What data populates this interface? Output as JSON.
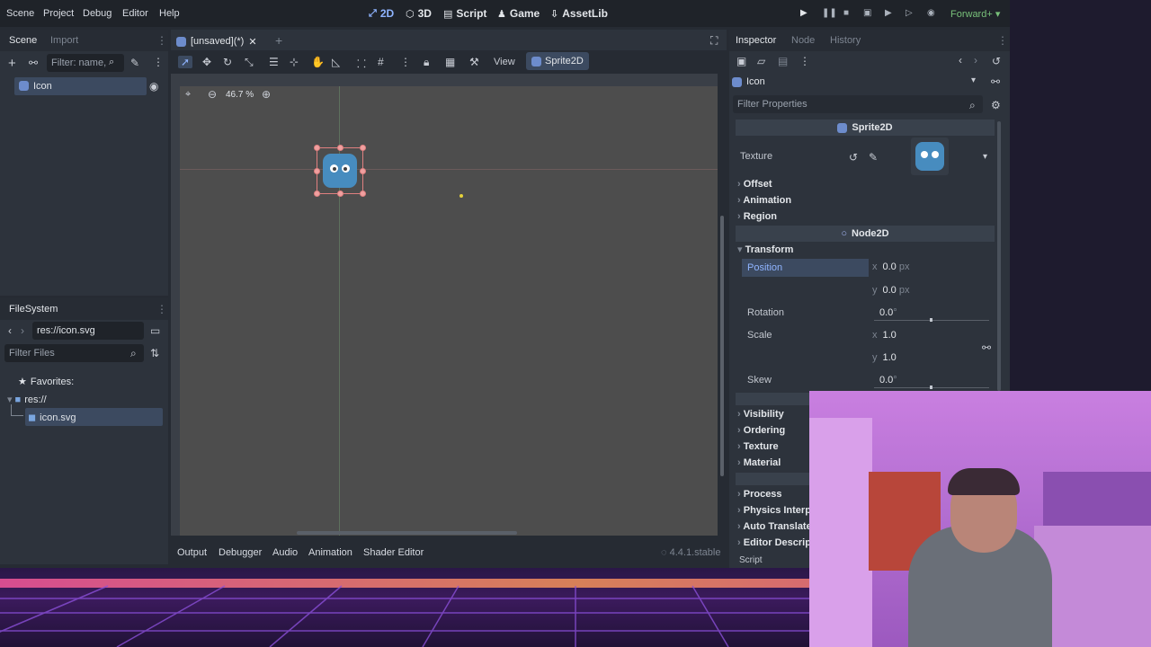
{
  "menu": [
    "Scene",
    "Project",
    "Debug",
    "Editor",
    "Help"
  ],
  "workspaces": [
    {
      "label": "2D",
      "icon": "2d-icon",
      "active": true
    },
    {
      "label": "3D",
      "icon": "3d-icon",
      "active": false
    },
    {
      "label": "Script",
      "icon": "script-icon",
      "active": false
    },
    {
      "label": "Game",
      "icon": "game-icon",
      "active": false
    },
    {
      "label": "AssetLib",
      "icon": "assetlib-icon",
      "active": false
    }
  ],
  "renderer": "Forward+",
  "scene_dock": {
    "tabs": [
      "Scene",
      "Import"
    ],
    "filter_placeholder": "Filter: name,",
    "tree": [
      {
        "label": "Icon",
        "selected": true
      }
    ]
  },
  "filesystem": {
    "title": "FileSystem",
    "path": "res://icon.svg",
    "filter_placeholder": "Filter Files",
    "items": [
      {
        "label": "Favorites:",
        "icon": "star-icon"
      },
      {
        "label": "res://",
        "icon": "folder-icon"
      },
      {
        "label": "icon.svg",
        "icon": "file-icon",
        "selected": true
      }
    ]
  },
  "editor": {
    "scene_tab": "[unsaved](*)",
    "view_label": "View",
    "node_label": "Sprite2D",
    "zoom": "46.7 %"
  },
  "bottom_tabs": [
    "Output",
    "Debugger",
    "Audio",
    "Animation",
    "Shader Editor"
  ],
  "version": "4.4.1.stable",
  "inspector": {
    "tabs": [
      "Inspector",
      "Node",
      "History"
    ],
    "object": "Icon",
    "filter_placeholder": "Filter Properties",
    "class_sprite": "Sprite2D",
    "texture_label": "Texture",
    "sprite_groups": [
      "Offset",
      "Animation",
      "Region"
    ],
    "class_node2d": "Node2D",
    "transform_label": "Transform",
    "position_label": "Position",
    "pos_x": "0.0",
    "pos_y": "0.0",
    "px": "px",
    "rotation_label": "Rotation",
    "rotation": "0.0",
    "deg": "°",
    "scale_label": "Scale",
    "scale_x": "1.0",
    "scale_y": "1.0",
    "skew_label": "Skew",
    "skew": "0.0",
    "canvas_groups": [
      "Visibility",
      "Ordering",
      "Texture",
      "Material"
    ],
    "node_groups": [
      "Process",
      "Physics Interp",
      "Auto Translate",
      "Editor Descrip"
    ],
    "script_label": "Script",
    "axis_x": "x",
    "axis_y": "y"
  },
  "colors": {
    "accent": "#8fb4ff",
    "selection": "#3c4a60",
    "panel": "#2d333c"
  }
}
